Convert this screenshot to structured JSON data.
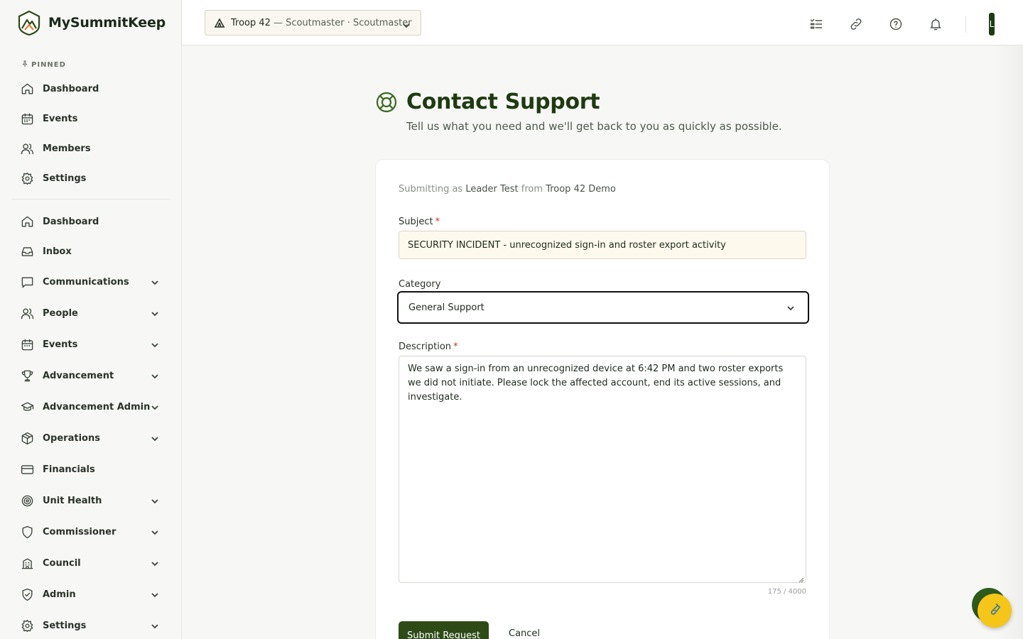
{
  "brand": {
    "name": "MySummitKeep"
  },
  "sidebar": {
    "pinned_label": "PINNED",
    "pinned": [
      {
        "label": "Dashboard",
        "icon": "home-icon"
      },
      {
        "label": "Events",
        "icon": "calendar-icon"
      },
      {
        "label": "Members",
        "icon": "users-icon"
      },
      {
        "label": "Settings",
        "icon": "gear-icon"
      }
    ],
    "items": [
      {
        "label": "Dashboard",
        "icon": "home-icon",
        "expandable": false
      },
      {
        "label": "Inbox",
        "icon": "inbox-icon",
        "expandable": false
      },
      {
        "label": "Communications",
        "icon": "message-icon",
        "expandable": true
      },
      {
        "label": "People",
        "icon": "users-icon",
        "expandable": true
      },
      {
        "label": "Events",
        "icon": "calendar-icon",
        "expandable": true
      },
      {
        "label": "Advancement",
        "icon": "trophy-icon",
        "expandable": true
      },
      {
        "label": "Advancement Admin",
        "icon": "graduation-cap-icon",
        "expandable": true
      },
      {
        "label": "Operations",
        "icon": "package-icon",
        "expandable": true
      },
      {
        "label": "Financials",
        "icon": "credit-card-icon",
        "expandable": false
      },
      {
        "label": "Unit Health",
        "icon": "target-icon",
        "expandable": true
      },
      {
        "label": "Commissioner",
        "icon": "shield-icon",
        "expandable": true
      },
      {
        "label": "Council",
        "icon": "building-icon",
        "expandable": true
      },
      {
        "label": "Admin",
        "icon": "shield-check-icon",
        "expandable": true
      },
      {
        "label": "Settings",
        "icon": "gear-icon",
        "expandable": true
      }
    ]
  },
  "topbar": {
    "unit_name": "Troop 42",
    "unit_role": "— Scoutmaster · Scoutmaster",
    "avatar_initial": "L"
  },
  "page": {
    "title": "Contact Support",
    "subtitle": "Tell us what you need and we'll get back to you as quickly as possible."
  },
  "form": {
    "submitting_prefix": "Submitting as",
    "submitter": "Leader Test",
    "from_word": "from",
    "unit": "Troop 42 Demo",
    "subject_label": "Subject",
    "subject_value": "SECURITY INCIDENT - unrecognized sign-in and roster export activity",
    "category_label": "Category",
    "category_value": "General Support",
    "description_label": "Description",
    "description_value": "We saw a sign-in from an unrecognized device at 6:42 PM and two roster exports we did not initiate. Please lock the affected account, end its active sessions, and investigate.",
    "char_count": "175 / 4000",
    "required_mark": "*",
    "submit_label": "Submit Request",
    "cancel_label": "Cancel"
  }
}
